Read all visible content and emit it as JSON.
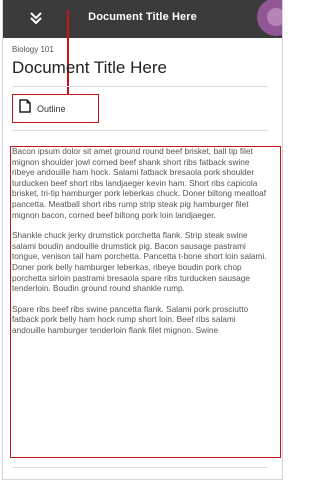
{
  "header": {
    "title": "Document Title Here",
    "collapse_icon": "chevron-down-double-icon",
    "avatar_icon": "profile-avatar-icon"
  },
  "document": {
    "course": "Biology 101",
    "title": "Document Title Here"
  },
  "outline_button": {
    "label": "Outline",
    "icon": "document-icon"
  },
  "content": {
    "paragraphs": [
      "Bacon ipsum dolor sit amet ground round beef brisket, ball tip filet mignon shoulder jowl corned beef shank short ribs fatback swine ribeye andouille ham hock. Salami fatback bresaola pork shoulder turducken beef short ribs landjaeger kevin ham. Short ribs capicola brisket, tri-tip hamburger pork leberkas chuck. Doner biltong meatloaf pancetta. Meatball short ribs rump strip steak pig hamburger filet mignon bacon, corned beef biltong pork loin landjaeger.",
      "Shankle chuck jerky drumstick porchetta flank. Strip steak swine salami boudin andouille drumstick pig. Bacon sausage pastrami tongue, venison tail ham porchetta. Pancetta t-bone short loin salami. Doner pork belly hamburger leberkas, ribeye boudin pork chop porchetta sirloin pastrami bresaola spare ribs turducken sausage tenderloin. Boudin ground round shankle rump.",
      "Spare ribs beef ribs swine pancetta flank. Salami pork prosciutto fatback pork belly ham hock rump short loin. Beef ribs salami andouille hamburger tenderloin flank filet mignon. Swine"
    ]
  },
  "colors": {
    "header_bg": "#3b3b3b",
    "annotation": "#c8151b",
    "avatar": "#9a5aa0"
  }
}
